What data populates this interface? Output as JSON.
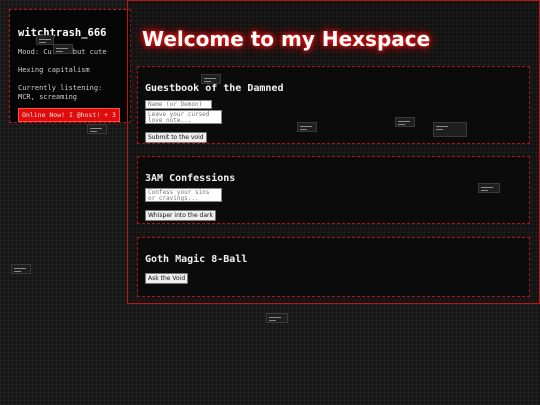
{
  "profile": {
    "username": "witchtrash_666",
    "mood": "Mood: Cursed but cute",
    "hexing": "Hexing capitalism",
    "listening": "Currently listening: MCR, screaming",
    "status": "Online Now! I @host! + 3"
  },
  "header": {
    "title": "Welcome to my Hexspace"
  },
  "guestbook": {
    "title": "Guestbook of the Damned",
    "name_placeholder": "Name (or Demon)",
    "note_placeholder": "Leave your cursed love note...",
    "submit_label": "Submit to the void"
  },
  "confessions": {
    "title": "3AM Confessions",
    "placeholder": "Confess your sins or cravings...",
    "submit_label": "Whisper into the dark"
  },
  "magic8": {
    "title": "Goth Magic 8-Ball",
    "button_label": "Ask the Void"
  },
  "colors": {
    "accent": "#e00b0b",
    "glow": "#ff1b1b",
    "panel_bg": "#0b0b0b"
  }
}
